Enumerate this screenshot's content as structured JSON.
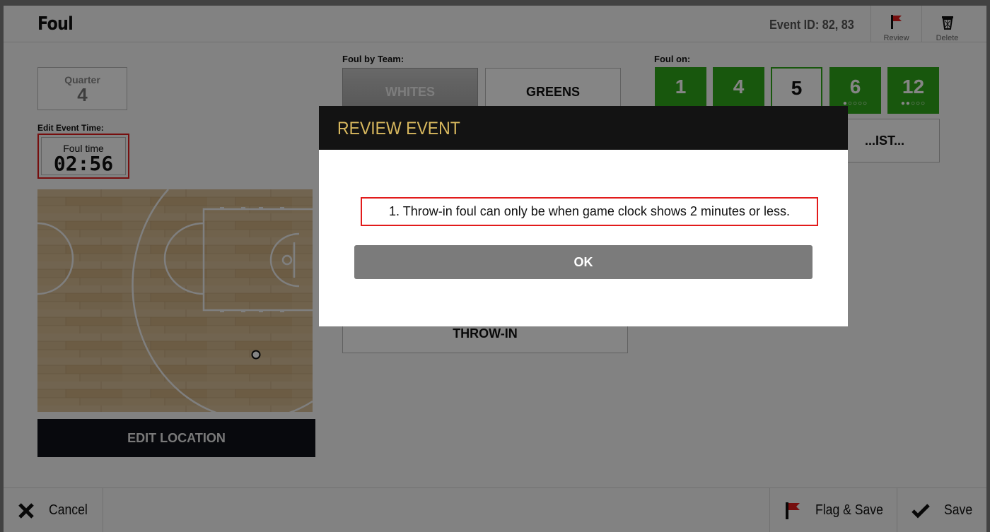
{
  "header": {
    "title": "Foul",
    "event_id": "Event ID: 82, 83",
    "review_label": "Review",
    "delete_label": "Delete"
  },
  "quarter": {
    "label": "Quarter",
    "value": "4"
  },
  "event_time": {
    "section_label": "Edit Event Time:",
    "label": "Foul time",
    "value": "02:56"
  },
  "location": {
    "button_label": "EDIT LOCATION"
  },
  "foul_by_team": {
    "label": "Foul by Team:",
    "teams": [
      {
        "label": "WHITES"
      },
      {
        "label": "GREENS"
      }
    ]
  },
  "foul_type": {
    "throw_in_label": "THROW-IN"
  },
  "foul_on": {
    "label": "Foul on:",
    "players": [
      {
        "number": "1",
        "dots": ""
      },
      {
        "number": "4",
        "dots": ""
      },
      {
        "number": "5",
        "dots": ""
      },
      {
        "number": "6",
        "dots": "●○○○○"
      },
      {
        "number": "12",
        "dots": "●●○○○"
      }
    ],
    "assist_label": "...IST..."
  },
  "footer": {
    "cancel_label": "Cancel",
    "flag_save_label": "Flag & Save",
    "save_label": "Save"
  },
  "dialog": {
    "title": "REVIEW EVENT",
    "message": "1. Throw-in foul can only be when game clock shows 2 minutes or less.",
    "ok_label": "OK"
  },
  "colors": {
    "accent_green": "#2fa71a",
    "dialog_title": "#d8b85e",
    "highlight_red": "#e21b1b",
    "flag_red": "#e21b1b"
  }
}
